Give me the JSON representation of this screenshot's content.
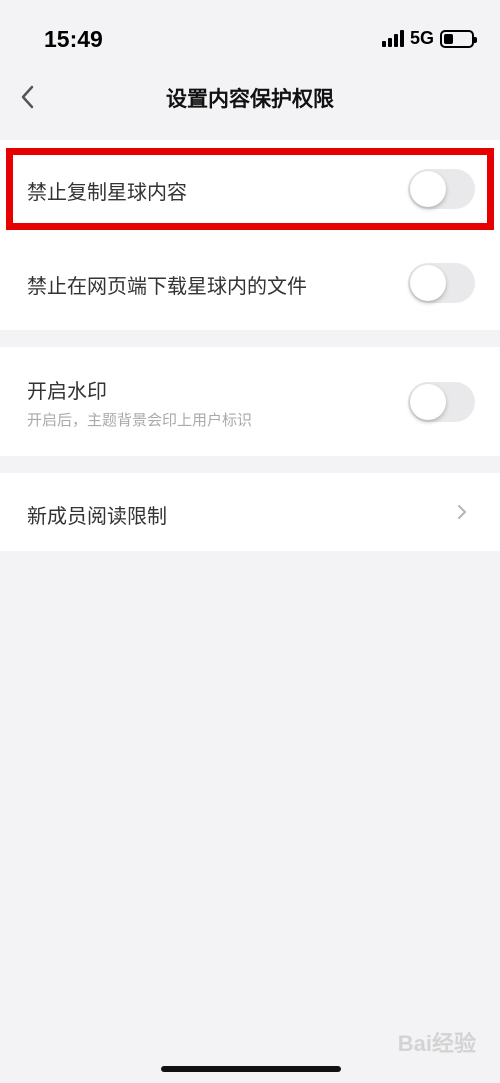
{
  "status_bar": {
    "time": "15:49",
    "network": "5G",
    "battery_level": 0.35
  },
  "nav": {
    "title": "设置内容保护权限",
    "back_icon": "chevron-left-icon"
  },
  "settings": {
    "forbid_copy": {
      "label": "禁止复制星球内容",
      "enabled": false
    },
    "forbid_download": {
      "label": "禁止在网页端下载星球内的文件",
      "enabled": false
    },
    "watermark": {
      "label": "开启水印",
      "description": "开启后，主题背景会印上用户标识",
      "enabled": false
    },
    "new_member_limit": {
      "label": "新成员阅读限制",
      "icon": "chevron-right-icon"
    }
  },
  "colors": {
    "highlight": "#e60000",
    "toggle_off": "#e9e9eb",
    "background": "#f3f3f5"
  },
  "watermark_brand": "Bai经验"
}
